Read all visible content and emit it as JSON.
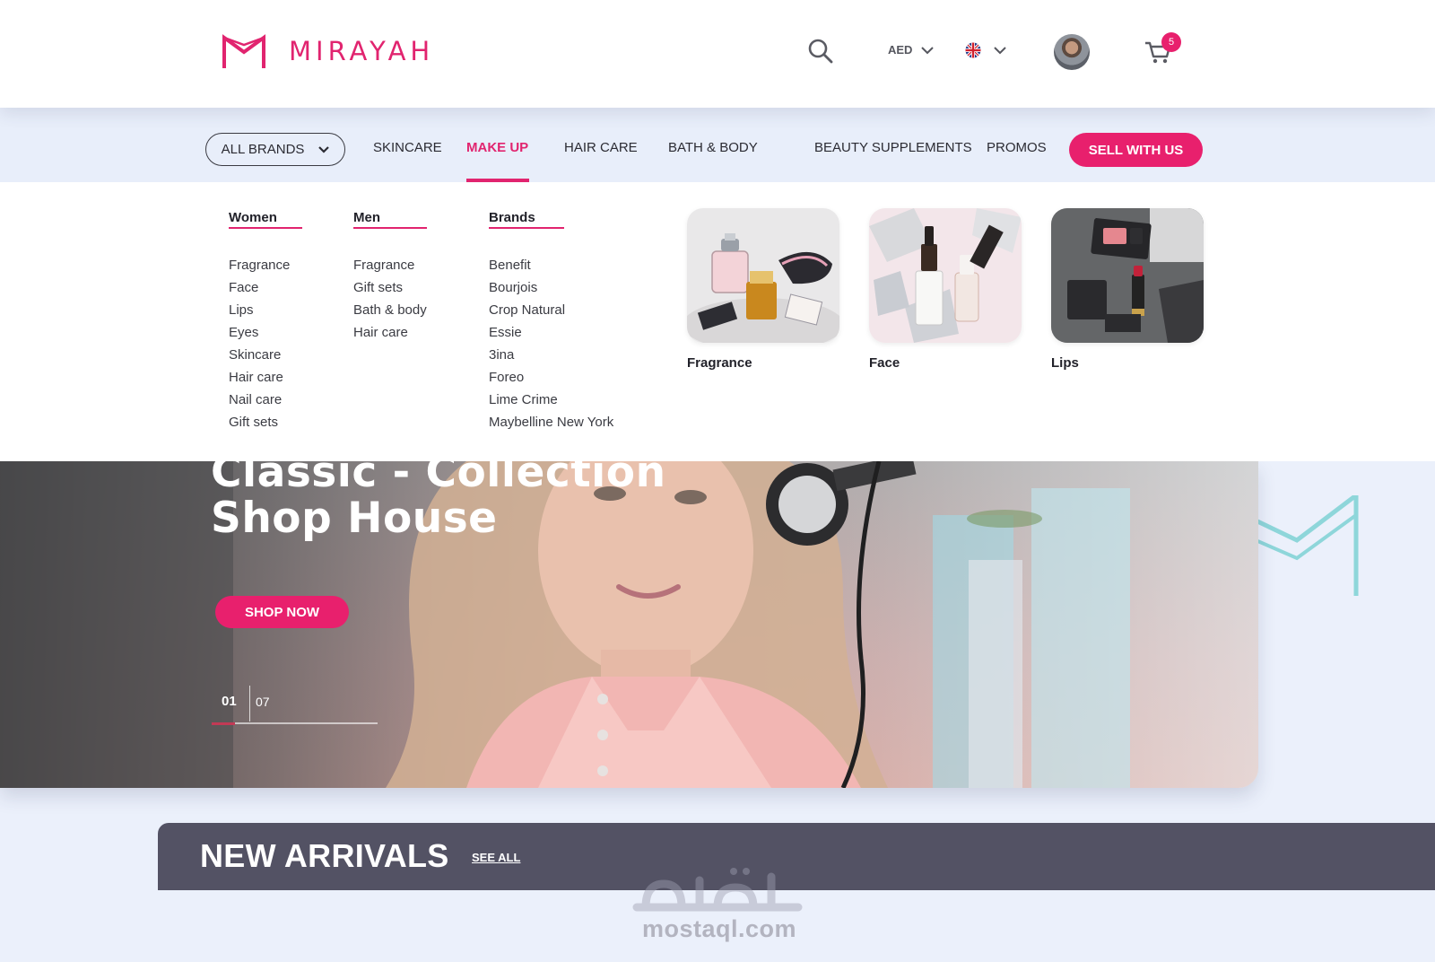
{
  "brand": {
    "name": "MIRAYAH",
    "accent": "#e1246f",
    "icon": "mirayah-m-logo"
  },
  "header": {
    "search_icon": "search-icon",
    "currency": "AED",
    "language_icon": "uk-flag-icon",
    "cart_count": "5"
  },
  "nav": {
    "all_brands": "ALL BRANDS",
    "items": [
      "SKINCARE",
      "MAKE UP",
      "HAIR CARE",
      "BATH & BODY",
      "BEAUTY SUPPLEMENTS",
      "PROMOS"
    ],
    "active": "MAKE UP",
    "cta": "SELL WITH US"
  },
  "mega_menu": {
    "columns": [
      {
        "heading": "Women",
        "items": [
          "Fragrance",
          "Face",
          "Lips",
          "Eyes",
          "Skincare",
          "Hair care",
          "Nail care",
          "Gift sets"
        ]
      },
      {
        "heading": "Men",
        "items": [
          "Fragrance",
          "Gift sets",
          "Bath & body",
          "Hair care"
        ]
      },
      {
        "heading": "Brands",
        "items": [
          "Benefit",
          "Bourjois",
          "Crop Natural",
          "Essie",
          "3ina",
          "Foreo",
          "Lime Crime",
          "Maybelline New York"
        ]
      }
    ],
    "cards": [
      {
        "label": "Fragrance"
      },
      {
        "label": "Face"
      },
      {
        "label": "Lips"
      }
    ]
  },
  "hero": {
    "title_line1": "Classic - Collection",
    "title_line2": "Shop House",
    "cta": "SHOP NOW",
    "slide_current": "01",
    "slide_total": "07",
    "slide_progress": 0.14
  },
  "new_arrivals": {
    "title": "NEW ARRIVALS",
    "see_all": "SEE ALL"
  },
  "watermark": {
    "latin": "mostaql.com"
  },
  "colors": {
    "accent": "#e8206d",
    "nav_bg": "#e8eefa",
    "page_bg": "#ebf0fb",
    "arrivals_bg": "#535264",
    "deco_teal": "#8ed6da"
  }
}
